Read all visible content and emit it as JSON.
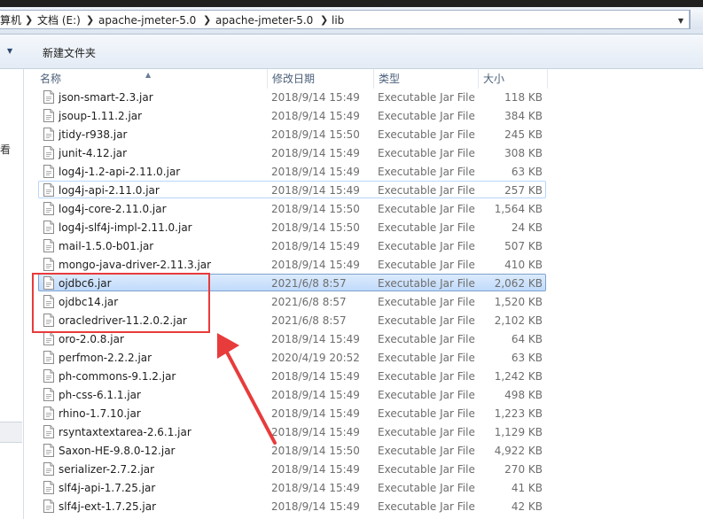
{
  "address_bar": {
    "crumbs": [
      "算机",
      "文档 (E:)",
      "apache-jmeter-5.0",
      "apache-jmeter-5.0",
      "lib"
    ],
    "separator": "❯"
  },
  "toolbar": {
    "new_folder_label": "新建文件夹"
  },
  "columns": {
    "name": "名称",
    "date": "修改日期",
    "type": "类型",
    "size": "大小"
  },
  "nav_partial_char": "看",
  "files": [
    {
      "name": "json-smart-2.3.jar",
      "date": "2018/9/14 15:49",
      "type": "Executable Jar File",
      "size": "118 KB"
    },
    {
      "name": "jsoup-1.11.2.jar",
      "date": "2018/9/14 15:49",
      "type": "Executable Jar File",
      "size": "384 KB"
    },
    {
      "name": "jtidy-r938.jar",
      "date": "2018/9/14 15:50",
      "type": "Executable Jar File",
      "size": "245 KB"
    },
    {
      "name": "junit-4.12.jar",
      "date": "2018/9/14 15:49",
      "type": "Executable Jar File",
      "size": "308 KB"
    },
    {
      "name": "log4j-1.2-api-2.11.0.jar",
      "date": "2018/9/14 15:49",
      "type": "Executable Jar File",
      "size": "63 KB"
    },
    {
      "name": "log4j-api-2.11.0.jar",
      "date": "2018/9/14 15:49",
      "type": "Executable Jar File",
      "size": "257 KB"
    },
    {
      "name": "log4j-core-2.11.0.jar",
      "date": "2018/9/14 15:50",
      "type": "Executable Jar File",
      "size": "1,564 KB"
    },
    {
      "name": "log4j-slf4j-impl-2.11.0.jar",
      "date": "2018/9/14 15:50",
      "type": "Executable Jar File",
      "size": "24 KB"
    },
    {
      "name": "mail-1.5.0-b01.jar",
      "date": "2018/9/14 15:49",
      "type": "Executable Jar File",
      "size": "507 KB"
    },
    {
      "name": "mongo-java-driver-2.11.3.jar",
      "date": "2018/9/14 15:49",
      "type": "Executable Jar File",
      "size": "410 KB"
    },
    {
      "name": "ojdbc6.jar",
      "date": "2021/6/8 8:57",
      "type": "Executable Jar File",
      "size": "2,062 KB"
    },
    {
      "name": "ojdbc14.jar",
      "date": "2021/6/8 8:57",
      "type": "Executable Jar File",
      "size": "1,520 KB"
    },
    {
      "name": "oracledriver-11.2.0.2.jar",
      "date": "2021/6/8 8:57",
      "type": "Executable Jar File",
      "size": "2,102 KB"
    },
    {
      "name": "oro-2.0.8.jar",
      "date": "2018/9/14 15:49",
      "type": "Executable Jar File",
      "size": "64 KB"
    },
    {
      "name": "perfmon-2.2.2.jar",
      "date": "2020/4/19 20:52",
      "type": "Executable Jar File",
      "size": "63 KB"
    },
    {
      "name": "ph-commons-9.1.2.jar",
      "date": "2018/9/14 15:49",
      "type": "Executable Jar File",
      "size": "1,242 KB"
    },
    {
      "name": "ph-css-6.1.1.jar",
      "date": "2018/9/14 15:49",
      "type": "Executable Jar File",
      "size": "498 KB"
    },
    {
      "name": "rhino-1.7.10.jar",
      "date": "2018/9/14 15:49",
      "type": "Executable Jar File",
      "size": "1,223 KB"
    },
    {
      "name": "rsyntaxtextarea-2.6.1.jar",
      "date": "2018/9/14 15:49",
      "type": "Executable Jar File",
      "size": "1,129 KB"
    },
    {
      "name": "Saxon-HE-9.8.0-12.jar",
      "date": "2018/9/14 15:50",
      "type": "Executable Jar File",
      "size": "4,922 KB"
    },
    {
      "name": "serializer-2.7.2.jar",
      "date": "2018/9/14 15:49",
      "type": "Executable Jar File",
      "size": "270 KB"
    },
    {
      "name": "slf4j-api-1.7.25.jar",
      "date": "2018/9/14 15:49",
      "type": "Executable Jar File",
      "size": "41 KB"
    },
    {
      "name": "slf4j-ext-1.7.25.jar",
      "date": "2018/9/14 15:49",
      "type": "Executable Jar File",
      "size": "42 KB"
    }
  ],
  "selected_file": "ojdbc6.jar",
  "hovered_file": "log4j-api-2.11.0.jar",
  "annotation": {
    "color": "#e83b3b"
  },
  "icons": {
    "file": "jar-file-icon",
    "dropdown": "chevron-down-icon"
  }
}
